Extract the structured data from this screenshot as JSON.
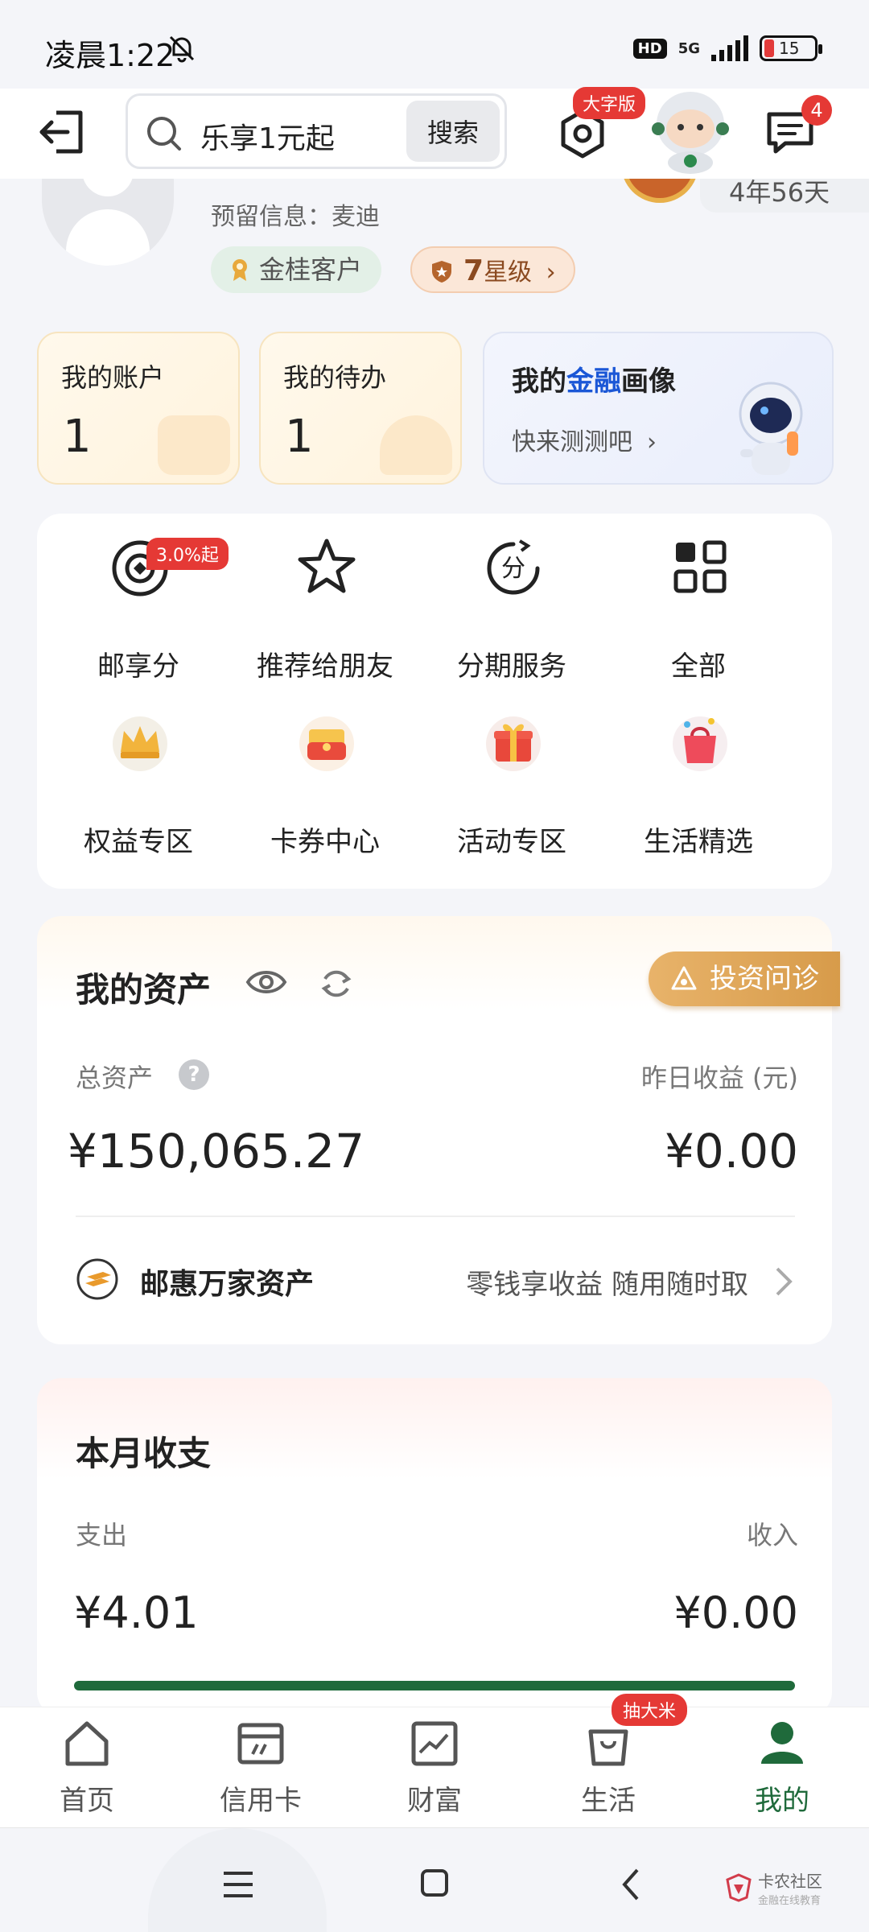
{
  "status": {
    "time": "凌晨1:22",
    "hd": "HD",
    "network": "5G",
    "battery": "15"
  },
  "header": {
    "search_text": "乐享1元起",
    "search_button": "搜索",
    "bigfont_badge": "大字版",
    "message_count": "4"
  },
  "profile": {
    "reserved_info": "预留信息：麦迪",
    "years": "4年56天",
    "tag_level": "金桂客户",
    "star_num": "7",
    "star_label": "星级",
    "star_chevron": "›"
  },
  "cards": {
    "account": {
      "label": "我的账户",
      "value": "1"
    },
    "todo": {
      "label": "我的待办",
      "value": "1"
    },
    "portrait": {
      "title_pre": "我的",
      "title_blue": "金融",
      "title_post": "画像",
      "subtitle": "快来测测吧",
      "chevron": "›"
    }
  },
  "menu": {
    "rate_badge": "3.0%起",
    "items": [
      {
        "label": "邮享分",
        "icon": "points-icon"
      },
      {
        "label": "推荐给朋友",
        "icon": "star-icon"
      },
      {
        "label": "分期服务",
        "icon": "installment-icon"
      },
      {
        "label": "全部",
        "icon": "grid-icon"
      },
      {
        "label": "权益专区",
        "icon": "crown-icon"
      },
      {
        "label": "卡券中心",
        "icon": "coupon-icon"
      },
      {
        "label": "活动专区",
        "icon": "gift-icon"
      },
      {
        "label": "生活精选",
        "icon": "shopping-bag-icon"
      }
    ]
  },
  "assets": {
    "title": "我的资产",
    "invest_button": "投资问诊",
    "total_label": "总资产",
    "help": "?",
    "yesterday_label": "昨日收益 (元)",
    "total_value": "¥150,065.27",
    "yesterday_value": "¥0.00",
    "youhui_label": "邮惠万家资产",
    "youhui_desc": "零钱享收益 随用随时取"
  },
  "monthly": {
    "title": "本月收支",
    "spend_label": "支出",
    "income_label": "收入",
    "spend_value": "¥4.01",
    "income_value": "¥0.00"
  },
  "bottom_nav": {
    "draw_badge": "抽大米",
    "items": [
      {
        "label": "首页"
      },
      {
        "label": "信用卡"
      },
      {
        "label": "财富"
      },
      {
        "label": "生活"
      },
      {
        "label": "我的"
      }
    ],
    "active_index": 4
  },
  "watermark": {
    "main": "卡农社区",
    "sub": "金融在线教育"
  },
  "colors": {
    "brand_green": "#1f6a3b",
    "badge_red": "#e53935",
    "portrait_blue": "#1b57d6"
  }
}
